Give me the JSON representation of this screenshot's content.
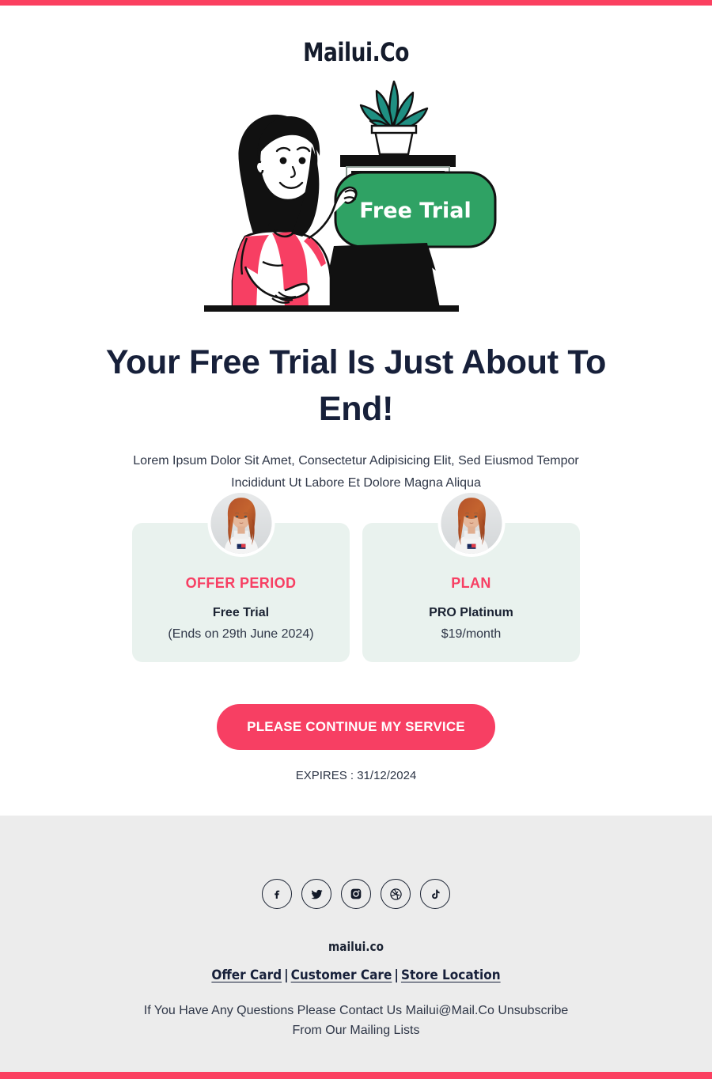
{
  "brand": {
    "logo": "Mailui.Co",
    "footer_name": "mailui.co"
  },
  "colors": {
    "accent_pink": "#f73f63",
    "bar_pink": "#fb4060",
    "bubble_green": "#2fa264",
    "card_bg": "#e9f2ee",
    "footer_bg": "#ececec",
    "heading": "#17203a"
  },
  "illustration": {
    "bubble_label": "Free Trial",
    "alt": "woman at laptop with free trial speech bubble"
  },
  "hero": {
    "headline": "Your Free Trial Is Just About To End!",
    "subcopy": "Lorem Ipsum Dolor Sit Amet, Consectetur Adipisicing Elit, Sed Eiusmod Tempor Incididunt Ut Labore Et Dolore Magna Aliqua"
  },
  "cards": [
    {
      "kicker": "OFFER PERIOD",
      "title": "Free Trial",
      "sub": "(Ends on 29th June 2024)",
      "avatar": "woman-avatar"
    },
    {
      "kicker": "PLAN",
      "title": "PRO Platinum",
      "sub": "$19/month",
      "avatar": "woman-avatar"
    }
  ],
  "cta": {
    "label": "PLEASE CONTINUE MY SERVICE"
  },
  "expires": {
    "label": "EXPIRES : 31/12/2024"
  },
  "footer": {
    "socials": [
      {
        "name": "facebook-icon",
        "label": "Facebook"
      },
      {
        "name": "twitter-icon",
        "label": "Twitter"
      },
      {
        "name": "instagram-icon",
        "label": "Instagram"
      },
      {
        "name": "dribbble-icon",
        "label": "Dribbble"
      },
      {
        "name": "tiktok-icon",
        "label": "TikTok"
      }
    ],
    "links": [
      {
        "label": "Offer Card"
      },
      {
        "label": "Customer Care"
      },
      {
        "label": "Store Location"
      }
    ],
    "separator": "|",
    "disclaimer": "If You Have Any Questions Please Contact Us Mailui@Mail.Co Unsubscribe From Our Mailing Lists"
  }
}
